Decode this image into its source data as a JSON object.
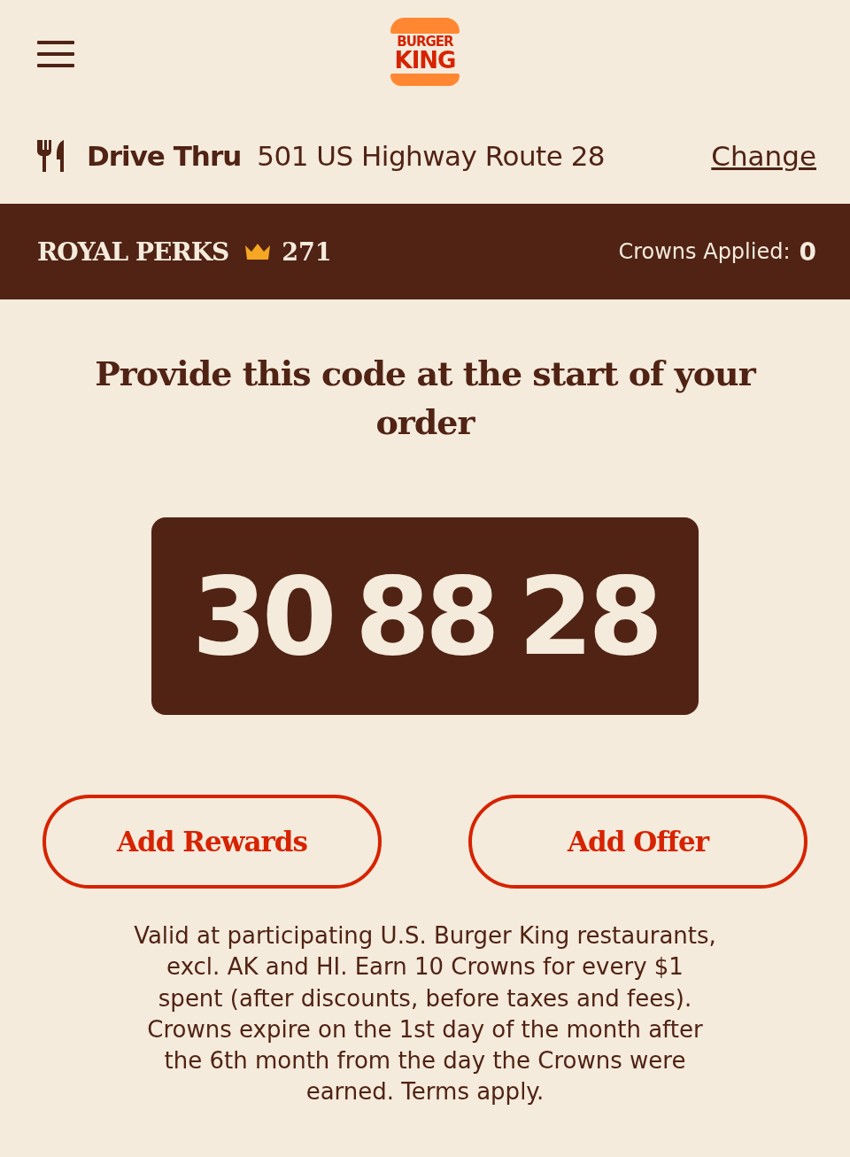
{
  "header": {
    "logo_lines": [
      "BURGER",
      "KING"
    ]
  },
  "location": {
    "mode": "Drive Thru",
    "address": "501 US Highway Route 28",
    "action": "Change"
  },
  "perks_bar": {
    "brand": "ROYAL PERKS",
    "crowns": "271",
    "applied_label": "Crowns Applied:",
    "applied_value": "0"
  },
  "heading": "Provide this code at the start of your order",
  "code": "30 88 28",
  "buttons": [
    "Add Rewards",
    "Add Offer"
  ],
  "disclaimer": "Valid at participating U.S. Burger King restaurants, excl. AK and HI. Earn 10 Crowns for every $1 spent (after discounts, before taxes and fees). Crowns expire on the 1st day of the month after the 6th month from the day the Crowns were earned. Terms apply."
}
